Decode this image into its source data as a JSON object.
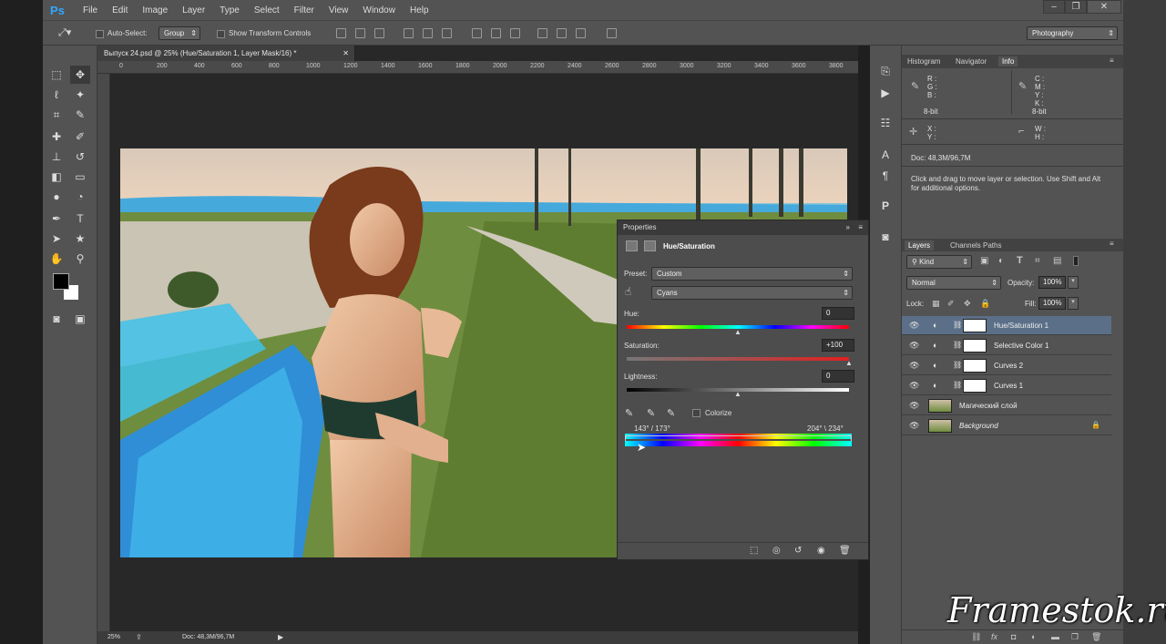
{
  "app": {
    "logo": "Ps",
    "workspace": "Photography"
  },
  "menu": [
    "File",
    "Edit",
    "Image",
    "Layer",
    "Type",
    "Select",
    "Filter",
    "View",
    "Window",
    "Help"
  ],
  "options": {
    "auto_select_label": "Auto-Select:",
    "auto_select_value": "Group",
    "transform_label": "Show Transform Controls"
  },
  "document": {
    "tab_title": "Выпуск 24.psd @ 25% (Hue/Saturation 1, Layer Mask/16) *",
    "zoom": "25%",
    "doc_size": "Doc: 48,3M/96,7M"
  },
  "ruler": [
    "0",
    "200",
    "400",
    "600",
    "800",
    "1000",
    "1200",
    "1400",
    "1600",
    "1800",
    "2000",
    "2200",
    "2400",
    "2600",
    "2800",
    "3000",
    "3200",
    "3400",
    "3600",
    "3800"
  ],
  "properties": {
    "title": "Properties",
    "adjustment": "Hue/Saturation",
    "preset_label": "Preset:",
    "preset_value": "Custom",
    "channel": "Cyans",
    "hue_label": "Hue:",
    "hue_value": "0",
    "saturation_label": "Saturation:",
    "saturation_value": "+100",
    "lightness_label": "Lightness:",
    "lightness_value": "0",
    "colorize_label": "Colorize",
    "range_left": "143° / 173°",
    "range_right": "204° \\ 234°"
  },
  "info_panel": {
    "tabs": [
      "Histogram",
      "Navigator",
      "Info"
    ],
    "active_tab": "Info",
    "rgb": [
      "R :",
      "G :",
      "B :"
    ],
    "cmyk": [
      "C :",
      "M :",
      "Y :",
      "K :"
    ],
    "bit_left": "8-bit",
    "bit_right": "8-bit",
    "xy": [
      "X :",
      "Y :"
    ],
    "wh": [
      "W :",
      "H :"
    ],
    "doc": "Doc: 48,3M/96,7M",
    "hint": "Click and drag to move layer or selection.  Use Shift and Alt for additional options."
  },
  "layers_panel": {
    "tabs": [
      "Layers",
      "Channels",
      "Paths"
    ],
    "active_tab": "Layers",
    "kind": "Kind",
    "blend": "Normal",
    "opacity_label": "Opacity:",
    "opacity": "100%",
    "lock_label": "Lock:",
    "fill_label": "Fill:",
    "fill": "100%",
    "layers": [
      {
        "name": "Hue/Saturation 1",
        "selected": true
      },
      {
        "name": "Selective Color 1",
        "selected": false
      },
      {
        "name": "Curves 2",
        "selected": false
      },
      {
        "name": "Curves 1",
        "selected": false
      },
      {
        "name": "Магический слой",
        "selected": false
      },
      {
        "name": "Background",
        "selected": false
      }
    ]
  },
  "watermark": "Framestok.ru",
  "colors": {
    "accent": "#31a8ff",
    "selected_layer": "#5b6f88",
    "panel": "#535353"
  }
}
